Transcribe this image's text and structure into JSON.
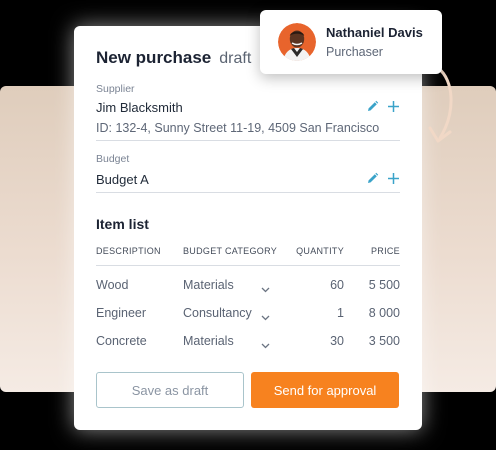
{
  "purchase": {
    "title": "New purchase",
    "status_tag": "draft"
  },
  "supplier": {
    "label": "Supplier",
    "name": "Jim Blacksmith",
    "details": "ID: 132-4, Sunny Street 11-19, 4509 San Francisco"
  },
  "budget": {
    "label": "Budget",
    "value": "Budget A"
  },
  "items": {
    "title": "Item list",
    "headers": {
      "description": "DESCRIPTION",
      "category": "BUDGET CATEGORY",
      "quantity": "QUANTITY",
      "price": "PRICE"
    },
    "rows": [
      {
        "description": "Wood",
        "category": "Materials",
        "quantity": "60",
        "price": "5 500"
      },
      {
        "description": "Engineer",
        "category": "Consultancy",
        "quantity": "1",
        "price": "8 000"
      },
      {
        "description": "Concrete",
        "category": "Materials",
        "quantity": "30",
        "price": "3 500"
      }
    ]
  },
  "actions": {
    "save_draft": "Save as draft",
    "send_approval": "Send for approval"
  },
  "user": {
    "name": "Nathaniel Davis",
    "role": "Purchaser"
  },
  "colors": {
    "accent": "#f7821f",
    "icon_blue": "#3aa3c9"
  },
  "icons": {
    "edit": "pencil-icon",
    "add": "plus-icon",
    "dropdown": "chevron-down-icon"
  }
}
